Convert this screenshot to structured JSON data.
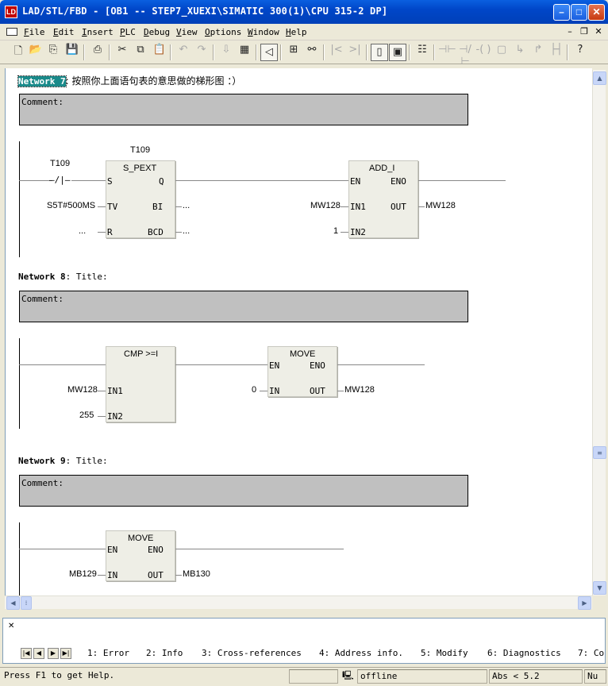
{
  "window": {
    "title": "LAD/STL/FBD  - [OB1 -- STEP7_XUEXI\\SIMATIC 300(1)\\CPU 315-2 DP]",
    "icon_name": "step7-app-icon"
  },
  "menu": [
    "File",
    "Edit",
    "Insert",
    "PLC",
    "Debug",
    "View",
    "Options",
    "Window",
    "Help"
  ],
  "networks": {
    "n7": {
      "label": "Network 7",
      "title": ": 按照你上面语句表的意思做的梯形图 ：）",
      "comment": "Comment:",
      "contact_addr": "T109",
      "contact_symbol": "—/|—",
      "timer_name": "T109",
      "timer_type": "S_PEXT",
      "timer_pins": [
        "S",
        "Q",
        "TV",
        "BI",
        "R",
        "BCD"
      ],
      "tv_param": "S5T#500MS",
      "bi_out": "...",
      "r_in": "...",
      "bcd_out": "...",
      "add_type": "ADD_I",
      "add_pins": [
        "EN",
        "ENO",
        "IN1",
        "OUT",
        "IN2"
      ],
      "add_in1": "MW128",
      "add_in2": "1",
      "add_out": "MW128"
    },
    "n8": {
      "label": "Network 8",
      "title": ": Title:",
      "comment": "Comment:",
      "cmp_type": "CMP >=I",
      "cmp_pins": [
        "IN1",
        "IN2"
      ],
      "cmp_in1": "MW128",
      "cmp_in2": "255",
      "move_type": "MOVE",
      "move_pins": [
        "EN",
        "ENO",
        "IN",
        "OUT"
      ],
      "move_in": "0",
      "move_out": "MW128"
    },
    "n9": {
      "label": "Network 9",
      "title": ": Title:",
      "comment": "Comment:",
      "move_type": "MOVE",
      "move_pins": [
        "EN",
        "ENO",
        "IN",
        "OUT"
      ],
      "move_in": "MB129",
      "move_out": "MB130"
    }
  },
  "tabs": [
    "1: Error",
    "2: Info",
    "3: Cross-references",
    "4: Address info.",
    "5: Modify",
    "6: Diagnostics",
    "7: Co"
  ],
  "status": {
    "help": "Press F1 to get Help.",
    "mode": "offline",
    "abs": "Abs < 5.2",
    "ins": "Nu"
  }
}
